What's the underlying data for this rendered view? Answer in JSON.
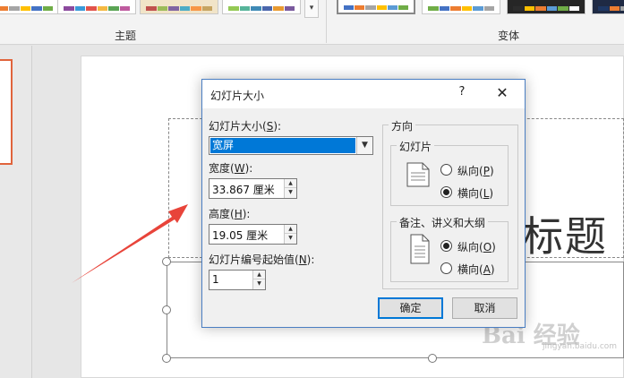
{
  "ribbon": {
    "group_theme": "主题",
    "group_variant": "变体",
    "theme_palettes": [
      [
        "#5b9bd5",
        "#ed7d31",
        "#a5a5a5",
        "#ffc000",
        "#4472c4",
        "#70ad47"
      ],
      [
        "#8c4a9e",
        "#3a9ad9",
        "#e2534b",
        "#f5b942",
        "#5aa454",
        "#bf5b9f"
      ],
      [
        "#c0504d",
        "#9bbb59",
        "#8064a2",
        "#4bacc6",
        "#f79646",
        "#c6a460"
      ],
      [
        "#94c954",
        "#56b49a",
        "#3f8ab6",
        "#4a66ac",
        "#e89a31",
        "#7a5a9e"
      ]
    ],
    "variant_palettes": [
      [
        "#4472c4",
        "#ed7d31",
        "#a5a5a5",
        "#ffc000",
        "#5b9bd5",
        "#70ad47"
      ],
      [
        "#70ad47",
        "#4472c4",
        "#ed7d31",
        "#ffc000",
        "#5b9bd5",
        "#a5a5a5"
      ],
      [
        "#2c2c2c",
        "#ffc000",
        "#ed7d31",
        "#5b9bd5",
        "#70ad47",
        "#ffffff"
      ],
      [
        "#1f3864",
        "#ed7d31",
        "#a5a5a5",
        "#ffc000",
        "#5b9bd5",
        "#70ad47"
      ]
    ]
  },
  "slide": {
    "title_text": "标题"
  },
  "dialog": {
    "title": "幻灯片大小",
    "help": "?",
    "close": "✕",
    "size_label": "幻灯片大小(",
    "size_key": "S",
    "size_suffix": "):",
    "size_value": "宽屏",
    "width_label": "宽度(",
    "width_key": "W",
    "width_suffix": "):",
    "width_value": "33.867 厘米",
    "height_label": "高度(",
    "height_key": "H",
    "height_suffix": "):",
    "height_value": "19.05 厘米",
    "number_label": "幻灯片编号起始值(",
    "number_key": "N",
    "number_suffix": "):",
    "number_value": "1",
    "orientation_legend": "方向",
    "slides_legend": "幻灯片",
    "slides_portrait": "纵向(",
    "slides_portrait_key": "P",
    "slides_landscape": "横向(",
    "slides_landscape_key": "L",
    "notes_legend": "备注、讲义和大纲",
    "notes_portrait": "纵向(",
    "notes_portrait_key": "O",
    "notes_landscape": "横向(",
    "notes_landscape_key": "A",
    "close_paren": ")",
    "ok": "确定",
    "cancel": "取消"
  },
  "watermark": {
    "main": "Bai 经验",
    "sub": "jingyan.baidu.com"
  },
  "colors": {
    "selection": "#0078d7",
    "arrow": "#e8443a",
    "accent": "#e0643c"
  }
}
